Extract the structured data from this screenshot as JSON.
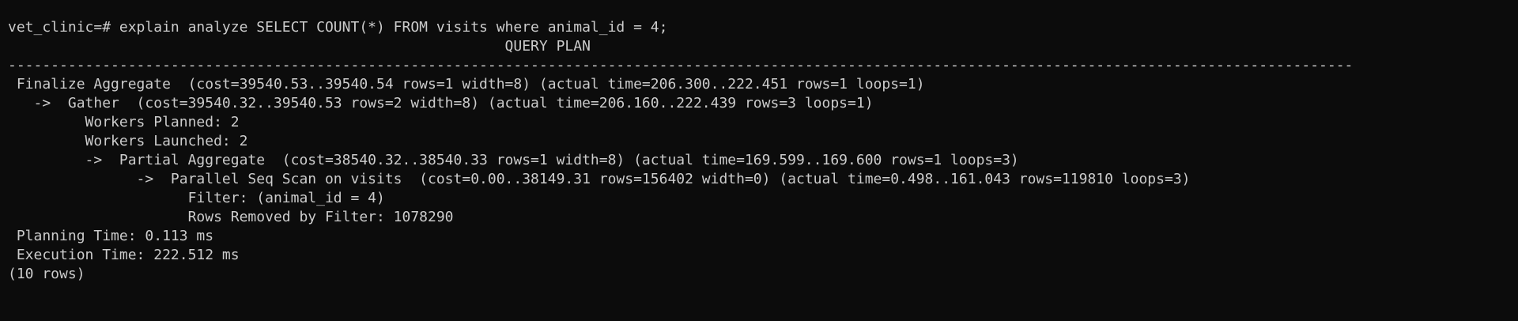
{
  "terminal": {
    "prompt": "vet_clinic=#",
    "command": " explain analyze SELECT COUNT(*) FROM visits where animal_id = 4;",
    "header": "                                                          QUERY PLAN",
    "separator": "-------------------------------------------------------------------------------------------------------------------------------------------------------------",
    "plan_rows": [
      " Finalize Aggregate  (cost=39540.53..39540.54 rows=1 width=8) (actual time=206.300..222.451 rows=1 loops=1)",
      "   ->  Gather  (cost=39540.32..39540.53 rows=2 width=8) (actual time=206.160..222.439 rows=3 loops=1)",
      "         Workers Planned: 2",
      "         Workers Launched: 2",
      "         ->  Partial Aggregate  (cost=38540.32..38540.33 rows=1 width=8) (actual time=169.599..169.600 rows=1 loops=3)",
      "               ->  Parallel Seq Scan on visits  (cost=0.00..38149.31 rows=156402 width=0) (actual time=0.498..161.043 rows=119810 loops=3)",
      "                     Filter: (animal_id = 4)",
      "                     Rows Removed by Filter: 1078290",
      " Planning Time: 0.113 ms",
      " Execution Time: 222.512 ms"
    ],
    "footer": "(10 rows)",
    "colors": {
      "background": "#0c0c0c",
      "foreground": "#cccccc"
    }
  }
}
